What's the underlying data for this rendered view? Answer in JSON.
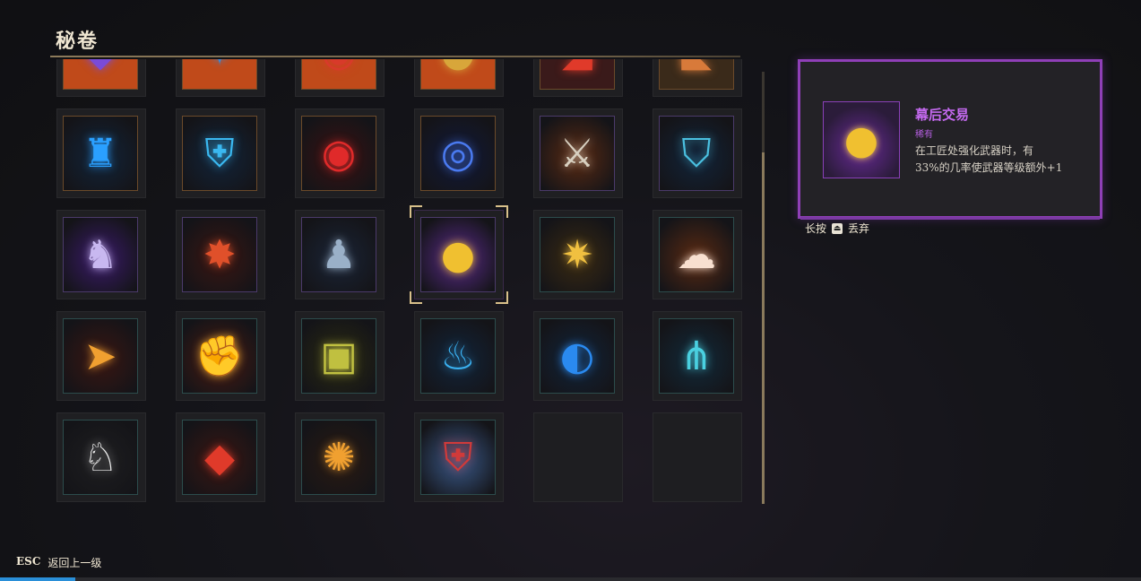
{
  "screen": {
    "title": "秘卷"
  },
  "grid": {
    "rows": [
      [
        {
          "icon": "purple-crystal-icon",
          "glyph": "◆",
          "color": "#7a4bd8",
          "bg": "#c04a1a",
          "border": "orange",
          "partial": true
        },
        {
          "icon": "blue-gem-icon",
          "glyph": "✦",
          "color": "#3a8ad8",
          "bg": "#c04a1a",
          "border": "orange",
          "partial": true
        },
        {
          "icon": "red-chain-icon",
          "glyph": "◉",
          "color": "#d83a2a",
          "bg": "#c04a1a",
          "border": "orange",
          "partial": true
        },
        {
          "icon": "gold-coin-icon",
          "glyph": "●",
          "color": "#d8a63a",
          "bg": "#c04a1a",
          "border": "orange",
          "partial": true
        },
        {
          "icon": "red-shard-icon",
          "glyph": "◢",
          "color": "#e03a2a",
          "bg": "#3a1a1a",
          "border": "orange",
          "partial": true
        },
        {
          "icon": "amber-shard-icon",
          "glyph": "◣",
          "color": "#d87a3a",
          "bg": "#3a2a1a",
          "border": "orange",
          "partial": true
        }
      ],
      [
        {
          "icon": "blue-cup-icon",
          "glyph": "♜",
          "color": "#2aa0ff",
          "bg": "#12243a",
          "border": "orange"
        },
        {
          "icon": "blue-shield-icon",
          "glyph": "⛨",
          "color": "#3ab8f0",
          "bg": "#12243a",
          "border": "orange"
        },
        {
          "icon": "red-orb-icon",
          "glyph": "◉",
          "color": "#e02a2a",
          "bg": "#3a1212",
          "border": "orange"
        },
        {
          "icon": "blue-vortex-icon",
          "glyph": "◎",
          "color": "#4a7af0",
          "bg": "#121a3a",
          "border": "orange"
        },
        {
          "icon": "crossed-swords-icon",
          "glyph": "⚔",
          "color": "#d8d0c0",
          "bg": "#5a2a12",
          "border": "purple"
        },
        {
          "icon": "blue-rune-shield-icon",
          "glyph": "⛉",
          "color": "#4ac0e0",
          "bg": "#12243a",
          "border": "purple"
        }
      ],
      [
        {
          "icon": "wolf-icon",
          "glyph": "♞",
          "color": "#c8b8f0",
          "bg": "#3a1a6a",
          "border": "purple"
        },
        {
          "icon": "red-explosion-icon",
          "glyph": "✸",
          "color": "#e0502a",
          "bg": "#3a1612",
          "border": "purple"
        },
        {
          "icon": "warrior-statue-icon",
          "glyph": "♟",
          "color": "#9ab0c8",
          "bg": "#1a2436",
          "border": "purple"
        },
        {
          "icon": "gold-coins-icon",
          "glyph": "●",
          "color": "#f0c030",
          "bg": "#5a2a8a",
          "border": "purple",
          "selected": true
        },
        {
          "icon": "golden-idol-icon",
          "glyph": "✷",
          "color": "#f0c040",
          "bg": "#3a2a12",
          "border": "teal"
        },
        {
          "icon": "fluffy-creature-icon",
          "glyph": "☁",
          "color": "#f8e0d0",
          "bg": "#5a2a12",
          "border": "teal"
        }
      ],
      [
        {
          "icon": "golden-arrowhead-icon",
          "glyph": "➤",
          "color": "#f0a030",
          "bg": "#3a1612",
          "border": "teal"
        },
        {
          "icon": "golden-gauntlet-icon",
          "glyph": "✊",
          "color": "#e0a030",
          "bg": "#4a1a12",
          "border": "teal"
        },
        {
          "icon": "green-chest-icon",
          "glyph": "▣",
          "color": "#c0c040",
          "bg": "#2a2a12",
          "border": "teal"
        },
        {
          "icon": "blue-boot-icon",
          "glyph": "♨",
          "color": "#3ab0f0",
          "bg": "#12243a",
          "border": "teal"
        },
        {
          "icon": "blue-axe-icon",
          "glyph": "◐",
          "color": "#2a8af0",
          "bg": "#12243a",
          "border": "teal"
        },
        {
          "icon": "blue-trident-icon",
          "glyph": "⋔",
          "color": "#4ad0e0",
          "bg": "#122a3a",
          "border": "teal"
        }
      ],
      [
        {
          "icon": "white-chicken-icon",
          "glyph": "♘",
          "color": "#f0f0f0",
          "bg": "#1e1e20",
          "border": "teal"
        },
        {
          "icon": "red-crystal-icon",
          "glyph": "◆",
          "color": "#e03a2a",
          "bg": "#3a1612",
          "border": "teal"
        },
        {
          "icon": "orange-vortex-icon",
          "glyph": "✺",
          "color": "#f0a030",
          "bg": "#2a1a12",
          "border": "teal"
        },
        {
          "icon": "mask-shield-icon",
          "glyph": "⛨",
          "color": "#d03a3a",
          "bg": "#3a5a8a",
          "border": "teal"
        },
        {
          "empty": true
        },
        {
          "empty": true
        }
      ]
    ]
  },
  "detail": {
    "name": "幕后交易",
    "rarity": "稀有",
    "description": "在工匠处强化武器时，有\n33%的几率使武器等级额外+1",
    "icon": "gold-coins-icon",
    "accent": "#8f3fb7"
  },
  "hint": {
    "label": "长按",
    "button_glyph": "⏏",
    "action": "丢弃"
  },
  "footer": {
    "key": "ESC",
    "label": "返回上一级"
  }
}
